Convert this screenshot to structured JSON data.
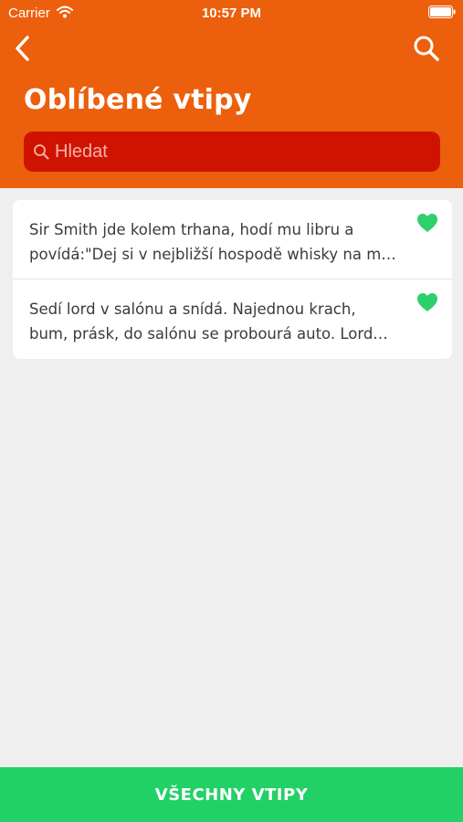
{
  "status_bar": {
    "carrier": "Carrier",
    "time": "10:57 PM",
    "wifi_icon": "wifi-icon",
    "battery_icon": "battery-full-icon"
  },
  "header": {
    "back_icon": "chevron-left-icon",
    "search_icon": "search-icon",
    "title": "Oblíbené vtipy",
    "background_color": "#ec5f0c"
  },
  "search": {
    "placeholder": "Hledat",
    "value": "",
    "background_color": "#d01301"
  },
  "jokes": [
    {
      "line1": "Sir Smith jde kolem trhana, hodí mu libru a",
      "line2": "povídá:\"Dej si v nejbližší hospodě whisky na m…",
      "favorite": true,
      "heart_color": "#2ed06b"
    },
    {
      "line1": "Sedí lord v salónu a snídá. Najednou krach,",
      "line2": "bum, prásk, do salónu se probourá auto. Lord…",
      "favorite": true,
      "heart_color": "#2ed06b"
    }
  ],
  "bottom_button": {
    "label": "VŠECHNY VTIPY",
    "background_color": "#22d165"
  }
}
